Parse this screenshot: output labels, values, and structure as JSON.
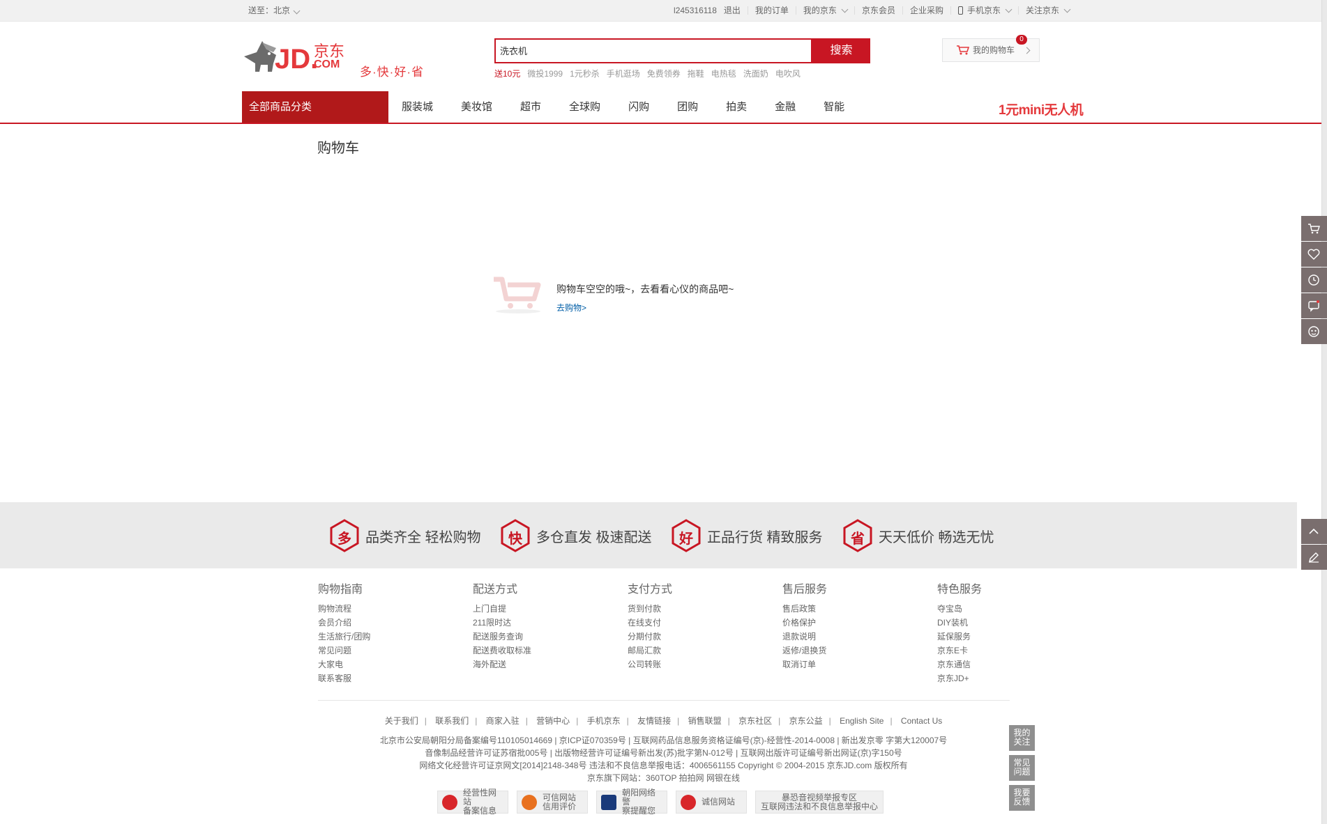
{
  "topbar": {
    "location_label": "送至：北京",
    "user": "l245316118",
    "logout": "退出",
    "items": [
      "我的订单",
      "我的京东",
      "京东会员",
      "企业采购",
      "手机京东",
      "关注京东"
    ]
  },
  "header": {
    "logo_text": "JD.京东.COM",
    "slogan": "多·快·好·省",
    "search": {
      "value": "洗衣机",
      "button": "搜索"
    },
    "hotwords": [
      "送10元",
      "微投1999",
      "1元秒杀",
      "手机逛场",
      "免费领券",
      "拖鞋",
      "电热毯",
      "洗面奶",
      "电吹风"
    ],
    "cart": {
      "label": "我的购物车",
      "count": "0"
    }
  },
  "nav": {
    "all_label": "全部商品分类",
    "items": [
      "服装城",
      "美妆馆",
      "超市",
      "全球购",
      "闪购",
      "团购",
      "拍卖",
      "金融",
      "智能"
    ],
    "promo": "1元mini无人机"
  },
  "main": {
    "title": "购物车",
    "empty_message": "购物车空空的哦~，去看看心仪的商品吧~",
    "go_shopping": "去购物>"
  },
  "slogans": [
    {
      "char": "多",
      "text": "品类齐全  轻松购物"
    },
    {
      "char": "快",
      "text": "多仓直发  极速配送"
    },
    {
      "char": "好",
      "text": "正品行货  精致服务"
    },
    {
      "char": "省",
      "text": "天天低价  畅选无忧"
    }
  ],
  "help": [
    {
      "title": "购物指南",
      "links": [
        "购物流程",
        "会员介绍",
        "生活旅行/团购",
        "常见问题",
        "大家电",
        "联系客服"
      ]
    },
    {
      "title": "配送方式",
      "links": [
        "上门自提",
        "211限时达",
        "配送服务查询",
        "配送费收取标准",
        "海外配送"
      ]
    },
    {
      "title": "支付方式",
      "links": [
        "货到付款",
        "在线支付",
        "分期付款",
        "邮局汇款",
        "公司转账"
      ]
    },
    {
      "title": "售后服务",
      "links": [
        "售后政策",
        "价格保护",
        "退款说明",
        "返修/退换货",
        "取消订单"
      ]
    },
    {
      "title": "特色服务",
      "links": [
        "夺宝岛",
        "DIY装机",
        "延保服务",
        "京东E卡",
        "京东通信",
        "京东JD+"
      ]
    }
  ],
  "footer": {
    "links": [
      "关于我们",
      "联系我们",
      "商家入驻",
      "营销中心",
      "手机京东",
      "友情链接",
      "销售联盟",
      "京东社区",
      "京东公益",
      "English Site",
      "Contact Us"
    ],
    "copy": [
      "北京市公安局朝阳分局备案编号110105014669  |  京ICP证070359号  |  互联网药品信息服务资格证编号(京)-经营性-2014-0008  |  新出发京零 字第大120007号",
      "音像制品经营许可证苏宿批005号  |  出版物经营许可证编号新出发(苏)批字第N-012号  |  互联网出版许可证编号新出网证(京)字150号",
      "网络文化经营许可证京网文[2014]2148-348号  违法和不良信息举报电话：4006561155  Copyright © 2004-2015  京东JD.com 版权所有",
      "京东旗下网站：360TOP  拍拍网  网银在线"
    ],
    "badges": [
      {
        "line1": "经营性网站",
        "line2": "备案信息",
        "color": "#d8262a"
      },
      {
        "line1": "可信网站",
        "line2": "信用评价",
        "color": "#e8711f"
      },
      {
        "line1": "朝阳网络警",
        "line2": "察提醒您",
        "color": "#1a3a7a"
      },
      {
        "line1": "诚信网站",
        "line2": "",
        "color": "#d8262a"
      },
      {
        "line1": "暴恐音视频举报专区",
        "line2": "互联网违法和不良信息举报中心",
        "color": ""
      }
    ]
  },
  "floating": {
    "my_follow": "我的关注",
    "faq": "常见问题",
    "feedback": "我要反馈"
  },
  "colors": {
    "brand_red": "#c81623",
    "nav_red": "#b1191a",
    "link_blue": "#005ea7"
  }
}
